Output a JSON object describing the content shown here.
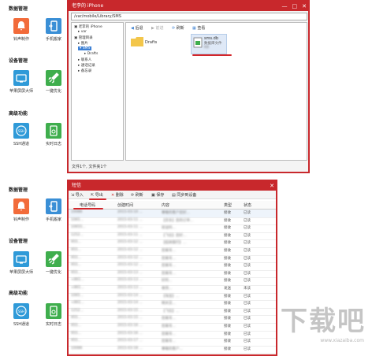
{
  "top_panel": {
    "sections": [
      {
        "title": "数据管理",
        "tiles": [
          {
            "label": "铃声制作",
            "icon": "bell-icon",
            "color": "#f26b3a"
          },
          {
            "label": "手机搬家",
            "icon": "phone-move-icon",
            "color": "#3a8fd6"
          }
        ]
      },
      {
        "title": "设备管理",
        "tiles": [
          {
            "label": "苹果屏屏大师",
            "icon": "screen-cast-icon",
            "color": "#2f9ad8"
          },
          {
            "label": "一键优化",
            "icon": "rocket-icon",
            "color": "#3fae4d"
          }
        ]
      },
      {
        "title": "高级功能",
        "tiles": [
          {
            "label": "SSH通道",
            "icon": "ssh-icon",
            "color": "#2f9ad8"
          },
          {
            "label": "实时日志",
            "icon": "log-icon",
            "color": "#3fae4d"
          }
        ]
      }
    ]
  },
  "bottom_panel": {
    "sections": [
      {
        "title": "数据管理",
        "tiles": [
          {
            "label": "铃声制作",
            "icon": "bell-icon",
            "color": "#f26b3a"
          },
          {
            "label": "手机搬家",
            "icon": "phone-move-icon",
            "color": "#3a8fd6"
          }
        ]
      },
      {
        "title": "设备管理",
        "tiles": [
          {
            "label": "苹果屏屏大师",
            "icon": "screen-cast-icon",
            "color": "#2f9ad8"
          },
          {
            "label": "一键优化",
            "icon": "rocket-icon",
            "color": "#3fae4d"
          }
        ]
      },
      {
        "title": "高级功能",
        "tiles": [
          {
            "label": "SSH通道",
            "icon": "ssh-icon",
            "color": "#2f9ad8"
          },
          {
            "label": "实时日志",
            "icon": "log-icon",
            "color": "#3fae4d"
          }
        ]
      }
    ]
  },
  "file_window": {
    "title": "老李的 iPhone",
    "path": "/var/mobile/Library/SMS",
    "toolbar": {
      "back": "后退",
      "forward": "前进",
      "refresh": "刷新",
      "view": "查看"
    },
    "tree": [
      {
        "label": "老李的 iPhone",
        "indent": 0
      },
      {
        "label": "var",
        "indent": 1
      },
      {
        "label": "管理目录",
        "indent": 0
      },
      {
        "label": "图片",
        "indent": 1
      },
      {
        "label": "SMS",
        "indent": 1
      },
      {
        "label": "Drafts",
        "indent": 2
      },
      {
        "label": "联系人",
        "indent": 1
      },
      {
        "label": "通话记录",
        "indent": 1
      },
      {
        "label": "备忘录",
        "indent": 1
      }
    ],
    "items": [
      {
        "name": "Drafts",
        "type": "folder"
      },
      {
        "name": "sms.db",
        "type": "数据库文件",
        "size": "KB"
      }
    ],
    "status": "文件1个, 文件夹1个"
  },
  "sms_window": {
    "title": "短信",
    "toolbar": [
      "导入",
      "导出",
      "删除",
      "刷新",
      "保存",
      "同步到设备"
    ],
    "columns": [
      "电话号码",
      "创建时间",
      "内容",
      "类型",
      "状态"
    ],
    "rows": [
      {
        "phone": "10086",
        "time": "2015-03-10 ...",
        "content": "尊敬的客户您好...",
        "type": "接收",
        "status": "已读"
      },
      {
        "phone": "1065...",
        "time": "2015-03-11 ...",
        "content": "【京东】您的订单...",
        "type": "接收",
        "status": "已读"
      },
      {
        "phone": "10655...",
        "time": "2015-03-11 ...",
        "content": "验证码...",
        "type": "接收",
        "status": "已读"
      },
      {
        "phone": "1252...",
        "time": "2015-03-11 ...",
        "content": "【飞信】您好...",
        "type": "接收",
        "status": "已读"
      },
      {
        "phone": "955...",
        "time": "2015-03-12 ...",
        "content": "【招商银行】...",
        "type": "接收",
        "status": "已读"
      },
      {
        "phone": "955...",
        "time": "2015-03-12 ...",
        "content": "您尾号...",
        "type": "接收",
        "status": "已读"
      },
      {
        "phone": "955...",
        "time": "2015-03-12 ...",
        "content": "您尾号...",
        "type": "接收",
        "status": "已读"
      },
      {
        "phone": "955...",
        "time": "2015-03-12 ...",
        "content": "您尾号...",
        "type": "接收",
        "status": "已读"
      },
      {
        "phone": "955...",
        "time": "2015-03-13 ...",
        "content": "您尾号...",
        "type": "接收",
        "status": "已读"
      },
      {
        "phone": "+861...",
        "time": "2015-03-13 ...",
        "content": "好的...",
        "type": "接收",
        "status": "已读"
      },
      {
        "phone": "+861...",
        "time": "2015-03-13 ...",
        "content": "收到...",
        "type": "发送",
        "status": "未读"
      },
      {
        "phone": "1065...",
        "time": "2015-03-14 ...",
        "content": "【淘宝】...",
        "type": "接收",
        "status": "已读"
      },
      {
        "phone": "+861...",
        "time": "2015-03-14 ...",
        "content": "明天见...",
        "type": "接收",
        "status": "已读"
      },
      {
        "phone": "1252...",
        "time": "2015-03-15 ...",
        "content": "【飞信】...",
        "type": "接收",
        "status": "已读"
      },
      {
        "phone": "955...",
        "time": "2015-03-15 ...",
        "content": "您尾号...",
        "type": "接收",
        "status": "已读"
      },
      {
        "phone": "955...",
        "time": "2015-03-16 ...",
        "content": "您尾号...",
        "type": "接收",
        "status": "已读"
      },
      {
        "phone": "955...",
        "time": "2015-03-16 ...",
        "content": "您尾号...",
        "type": "接收",
        "status": "已读"
      },
      {
        "phone": "955...",
        "time": "2015-03-17 ...",
        "content": "您尾号...",
        "type": "接收",
        "status": "已读"
      },
      {
        "phone": "10086",
        "time": "2015-03-18 ...",
        "content": "尊敬的客户...",
        "type": "接收",
        "status": "已读"
      }
    ]
  },
  "watermark": {
    "main": "下载吧",
    "url": "www.xiazaiba.com"
  },
  "colors": {
    "accent": "#c8282c",
    "highlight": "#d3262b"
  }
}
